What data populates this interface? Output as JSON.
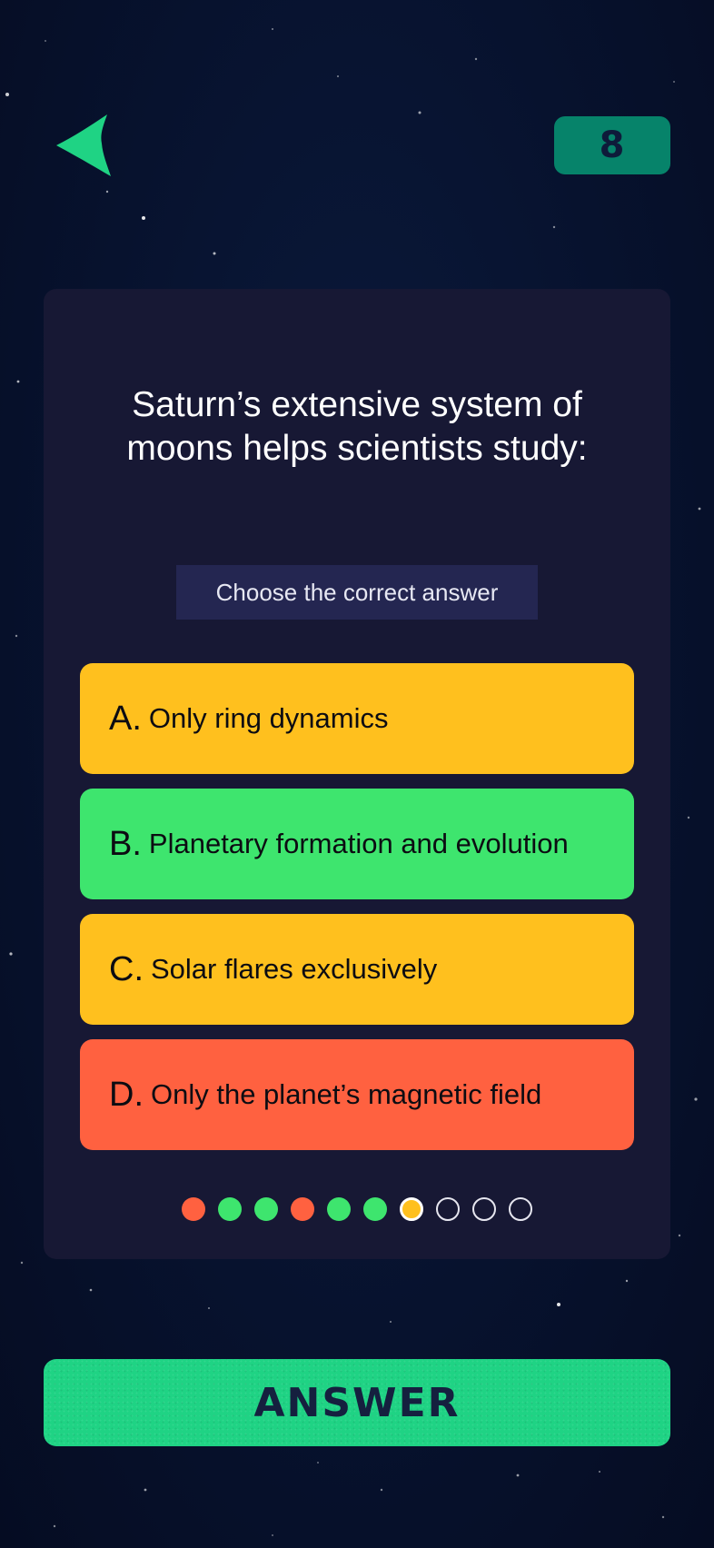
{
  "header": {
    "back_icon": "back-arrow-icon",
    "counter": "8"
  },
  "question": {
    "text": "Saturn’s extensive system of moons helps scientists study:",
    "hint": "Choose the correct answer"
  },
  "options": [
    {
      "letter": "A.",
      "text": "Only ring dynamics",
      "state": "neutral",
      "color": "#ffc01e"
    },
    {
      "letter": "B.",
      "text": "Planetary formation and evolution",
      "state": "correct",
      "color": "#3ee56e"
    },
    {
      "letter": "C.",
      "text": "Solar flares exclusively",
      "state": "neutral",
      "color": "#ffc01e"
    },
    {
      "letter": "D.",
      "text": "Only the planet’s magnetic field",
      "state": "wrong",
      "color": "#ff6140"
    }
  ],
  "progress": {
    "states": [
      "wrong",
      "correct",
      "correct",
      "wrong",
      "correct",
      "correct",
      "current",
      "empty",
      "empty",
      "empty"
    ]
  },
  "footer": {
    "answer_label": "ANSWER"
  },
  "colors": {
    "accent_green": "#1fd384",
    "counter_bg": "#06836a",
    "card_bg": "#171834",
    "option_yellow": "#ffc01e",
    "option_green": "#3ee56e",
    "option_red": "#ff6140"
  }
}
